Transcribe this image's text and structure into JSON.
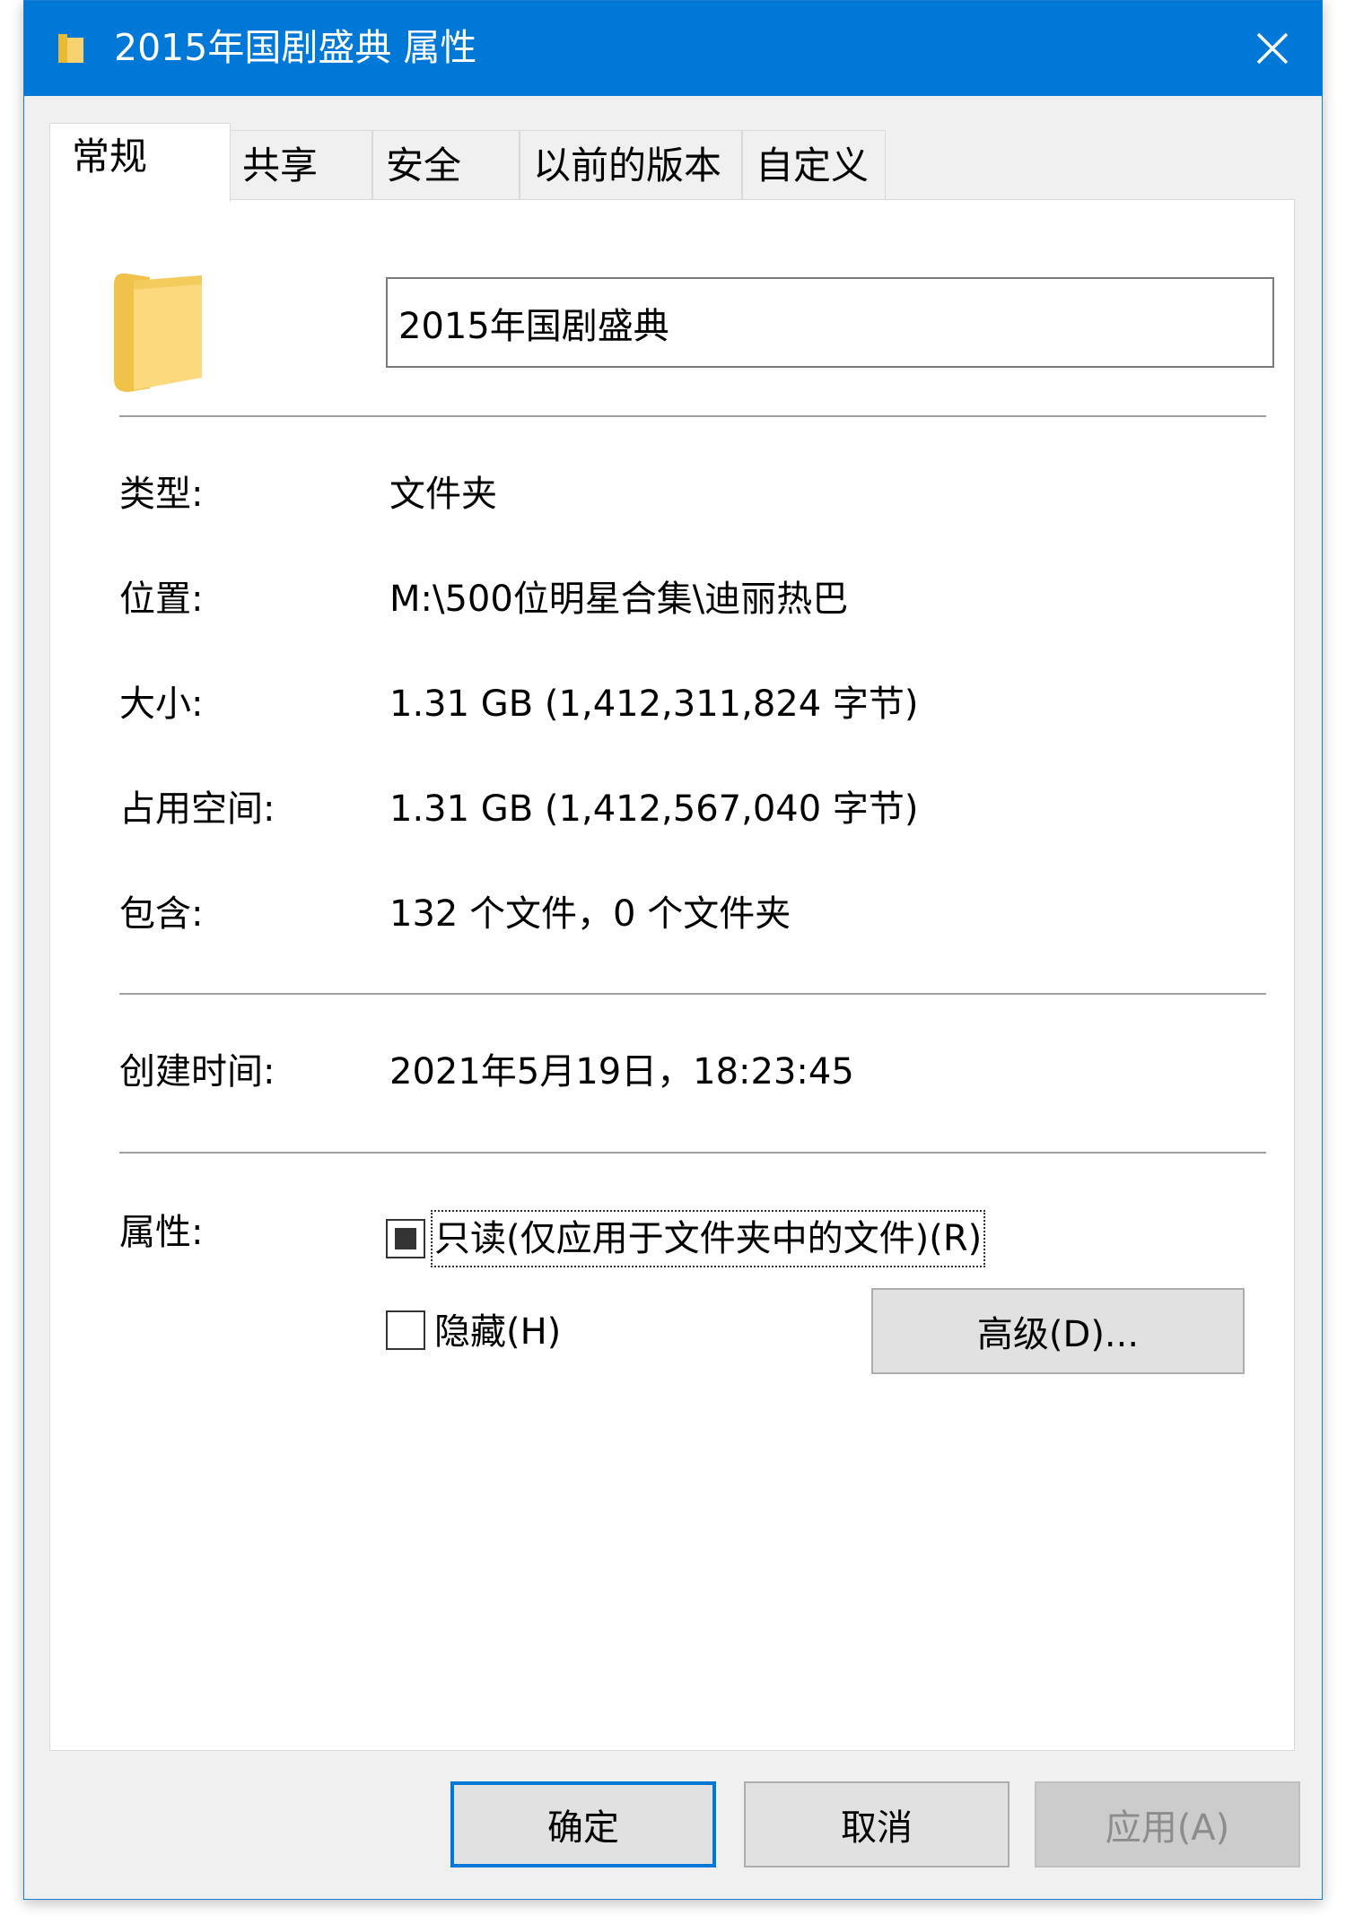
{
  "window": {
    "title": "2015年国剧盛典 属性",
    "close_icon": "close-icon",
    "folder_icon": "folder-icon",
    "folder_color": "#f7d26e",
    "accent_color": "#0078d7"
  },
  "tabs": [
    {
      "label": "常规",
      "active": true
    },
    {
      "label": "共享",
      "active": false
    },
    {
      "label": "安全",
      "active": false
    },
    {
      "label": "以前的版本",
      "active": false
    },
    {
      "label": "自定义",
      "active": false
    }
  ],
  "general": {
    "name_value": "2015年国剧盛典",
    "type_label": "类型:",
    "type_value": "文件夹",
    "location_label": "位置:",
    "location_value": "M:\\500位明星合集\\迪丽热巴",
    "size_label": "大小:",
    "size_value": "1.31 GB (1,412,311,824 字节)",
    "size_on_disk_label": "占用空间:",
    "size_on_disk_value": "1.31 GB (1,412,567,040 字节)",
    "contains_label": "包含:",
    "contains_value": "132 个文件，0 个文件夹",
    "created_label": "创建时间:",
    "created_value": "2021年5月19日，18:23:45",
    "attributes_label": "属性:",
    "readonly_label": "只读(仅应用于文件夹中的文件)(R)",
    "readonly_state": "indeterminate",
    "hidden_label": "隐藏(H)",
    "hidden_checked": false,
    "advanced_button": "高级(D)..."
  },
  "footer": {
    "ok_label": "确定",
    "cancel_label": "取消",
    "apply_label": "应用(A)",
    "apply_enabled": false
  }
}
